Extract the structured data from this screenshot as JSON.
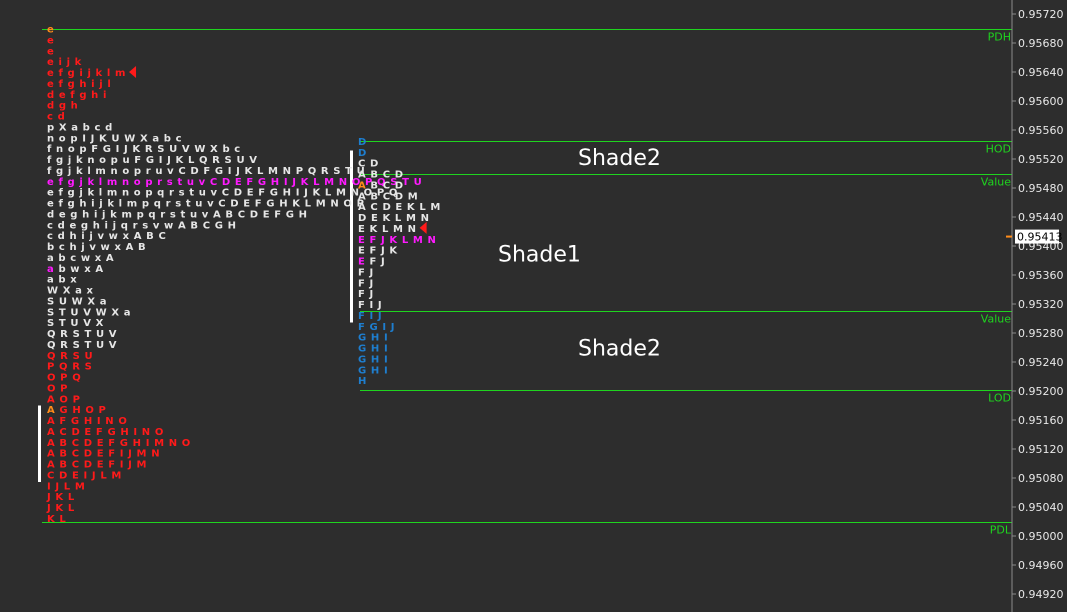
{
  "colors": {
    "background": "#2d2d2d",
    "level_line": "#1fd41f",
    "red": "#ff1a1a",
    "white": "#e6e6e6",
    "magenta": "#ff1aff",
    "blue": "#1e7ecf",
    "orange": "#ff8c1a",
    "axis_text": "#e8e8e8"
  },
  "chart_data": {
    "type": "market_profile",
    "y_axis": {
      "ylim": [
        0.94905,
        0.9574
      ],
      "ticks": [
        "0.95720",
        "0.95680",
        "0.95640",
        "0.95600",
        "0.95560",
        "0.95520",
        "0.95480",
        "0.95440",
        "0.95400",
        "0.95360",
        "0.95320",
        "0.95280",
        "0.95240",
        "0.95200",
        "0.95160",
        "0.95120",
        "0.95080",
        "0.95040",
        "0.95000",
        "0.94960",
        "0.94920"
      ]
    },
    "current_price": "0.95413",
    "levels": [
      {
        "label": "PDH",
        "price": 0.957,
        "profile": "left"
      },
      {
        "label": "HOD",
        "price": 0.95545,
        "profile": "right"
      },
      {
        "label": "Value",
        "price": 0.955,
        "profile": "right"
      },
      {
        "label": "Value",
        "price": 0.9531,
        "profile": "right"
      },
      {
        "label": "LOD",
        "price": 0.95201,
        "profile": "right"
      },
      {
        "label": "PDL",
        "price": 0.9502,
        "profile": "left"
      }
    ],
    "annotations": [
      {
        "text": "Shade2",
        "price": 0.95523
      },
      {
        "text": "Shade1",
        "price": 0.9539
      },
      {
        "text": "Shade2",
        "price": 0.9526
      }
    ],
    "profiles": [
      {
        "name": "left",
        "top_price": 0.957,
        "step": 0.00015,
        "rows": [
          {
            "text": "e",
            "color": "red",
            "first": "orange"
          },
          {
            "text": "e",
            "color": "red"
          },
          {
            "text": "e",
            "color": "red"
          },
          {
            "text": "e i j k",
            "color": "red"
          },
          {
            "text": "e f g i j k l m",
            "color": "red",
            "marker": true
          },
          {
            "text": "e f g h i j l",
            "color": "red"
          },
          {
            "text": "d e f g h i",
            "color": "red"
          },
          {
            "text": "d g h",
            "color": "red"
          },
          {
            "text": "c d",
            "color": "red"
          },
          {
            "text": "p X a b c d",
            "color": "white"
          },
          {
            "text": "n o p I J K U W X a b c",
            "color": "white"
          },
          {
            "text": "f n o p F G I J K R S U V W X b c",
            "color": "white"
          },
          {
            "text": "f g j k n o p u F G I J K L Q R S U V",
            "color": "white"
          },
          {
            "text": "f g j k l m n o p r u v C D F G I J K L M N P Q R S T U",
            "color": "white"
          },
          {
            "text": "e f g j k l m n o p r s t u v C D E F G H I J K L M N O P Q S T U",
            "color": "magenta"
          },
          {
            "text": "e f g j k l m n o p q r s t u v C D E F G H I J K L M N O P Q",
            "color": "white"
          },
          {
            "text": "e f g h i j k l m p q r s t u v C D E F G H K L M N O P",
            "color": "white"
          },
          {
            "text": "d e g h i j k m p q r s t u v A B C D E F G H",
            "color": "white"
          },
          {
            "text": "c d e g h i j q r s v w A B C G H",
            "color": "white"
          },
          {
            "text": "c d h i j v w x A B C",
            "color": "white"
          },
          {
            "text": "b c h j v w x A B",
            "color": "white"
          },
          {
            "text": "a b c w x A",
            "color": "white"
          },
          {
            "text": "a b w x A",
            "color": "white",
            "first": "magenta"
          },
          {
            "text": "a b x",
            "color": "white"
          },
          {
            "text": "W X a x",
            "color": "white"
          },
          {
            "text": "S U W X a",
            "color": "white"
          },
          {
            "text": "S T U V W X a",
            "color": "white"
          },
          {
            "text": "S T U V X",
            "color": "white"
          },
          {
            "text": "Q R S T U V",
            "color": "white"
          },
          {
            "text": "Q R S T U V",
            "color": "white"
          },
          {
            "text": "Q R S U",
            "color": "red"
          },
          {
            "text": "P Q R S",
            "color": "red"
          },
          {
            "text": "O P Q",
            "color": "red"
          },
          {
            "text": "O P",
            "color": "red"
          },
          {
            "text": "A O P",
            "color": "red"
          },
          {
            "text": "A G H O P",
            "color": "red",
            "first": "orange"
          },
          {
            "text": "A F G H I N O",
            "color": "red"
          },
          {
            "text": "A C D E F G H I N O",
            "color": "red"
          },
          {
            "text": "A B C D E F G H I M N O",
            "color": "red"
          },
          {
            "text": "A B C D E F I J M N",
            "color": "red"
          },
          {
            "text": "A B C D E F I J M",
            "color": "red"
          },
          {
            "text": "C D E I J L M",
            "color": "red"
          },
          {
            "text": "I J L M",
            "color": "red"
          },
          {
            "text": "J K L",
            "color": "red"
          },
          {
            "text": "J K L",
            "color": "red"
          },
          {
            "text": "K L",
            "color": "red"
          }
        ]
      },
      {
        "name": "right",
        "top_price": 0.95545,
        "step": 0.00015,
        "rows": [
          {
            "text": "D",
            "color": "blue"
          },
          {
            "text": "D",
            "color": "blue"
          },
          {
            "text": "C D",
            "color": "white"
          },
          {
            "text": "A B C D",
            "color": "white"
          },
          {
            "text": "A B C D",
            "color": "white",
            "first": "orange"
          },
          {
            "text": "A B C D M",
            "color": "white"
          },
          {
            "text": "A C D E K L M",
            "color": "white"
          },
          {
            "text": "D E K L M N",
            "color": "white"
          },
          {
            "text": "E K L M N",
            "color": "white",
            "marker": true
          },
          {
            "text": "E F J K L M N",
            "color": "magenta"
          },
          {
            "text": "E F J K",
            "color": "white"
          },
          {
            "text": "E F J",
            "color": "white",
            "first": "magenta"
          },
          {
            "text": "F J",
            "color": "white"
          },
          {
            "text": "F J",
            "color": "white"
          },
          {
            "text": "F J",
            "color": "white"
          },
          {
            "text": "F I J",
            "color": "white"
          },
          {
            "text": "F I J",
            "color": "blue"
          },
          {
            "text": "F G I J",
            "color": "blue"
          },
          {
            "text": "G H I",
            "color": "blue"
          },
          {
            "text": "G H I",
            "color": "blue"
          },
          {
            "text": "G H I",
            "color": "blue"
          },
          {
            "text": "G H I",
            "color": "blue"
          },
          {
            "text": "H",
            "color": "blue"
          }
        ]
      }
    ]
  }
}
